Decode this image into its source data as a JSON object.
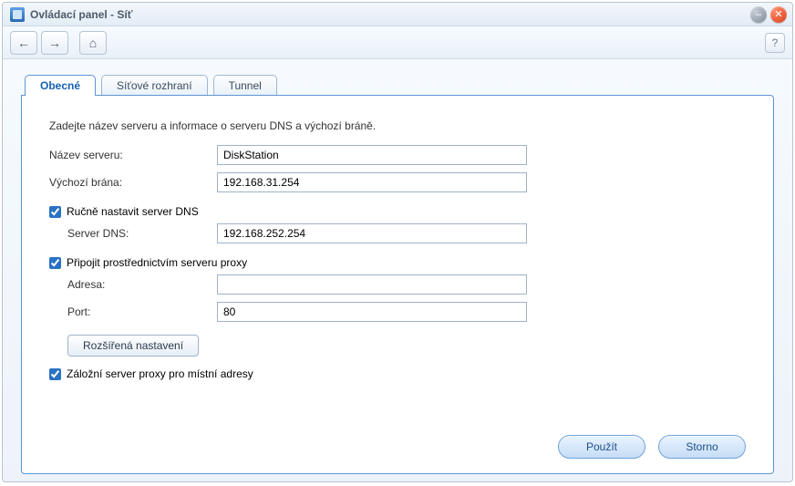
{
  "window": {
    "title": "Ovládací panel - Síť"
  },
  "tabs": {
    "general": "Obecné",
    "interface": "Síťové rozhraní",
    "tunnel": "Tunnel"
  },
  "form": {
    "description": "Zadejte název serveru a informace o serveru DNS a výchozí bráně.",
    "server_name_label": "Název serveru:",
    "server_name_value": "DiskStation",
    "gateway_label": "Výchozí brána:",
    "gateway_value": "192.168.31.254",
    "manual_dns_label": "Ručně nastavit server DNS",
    "manual_dns_checked": true,
    "dns_label": "Server DNS:",
    "dns_value": "192.168.252.254",
    "proxy_connect_label": "Připojit prostřednictvím serveru proxy",
    "proxy_connect_checked": true,
    "proxy_addr_label": "Adresa:",
    "proxy_addr_value": "",
    "proxy_port_label": "Port:",
    "proxy_port_value": "80",
    "advanced_btn": "Rozšířená nastavení",
    "proxy_bypass_label": "Záložní server proxy pro místní adresy",
    "proxy_bypass_checked": true
  },
  "buttons": {
    "apply": "Použít",
    "cancel": "Storno"
  }
}
